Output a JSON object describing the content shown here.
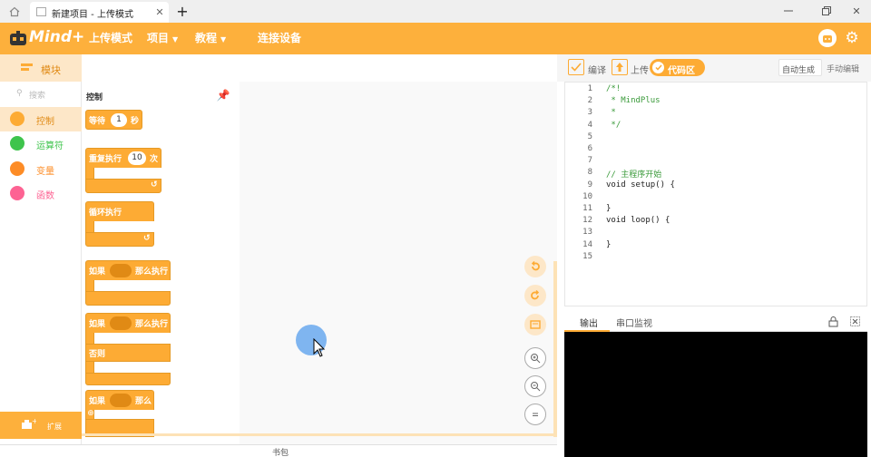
{
  "tab": {
    "title": "新建项目 - 上传模式"
  },
  "menubar": {
    "logo": "Mind+",
    "items": [
      {
        "label": "上传模式"
      },
      {
        "label": "项目"
      },
      {
        "label": "教程"
      },
      {
        "label": "连接设备"
      }
    ]
  },
  "sidebar": {
    "header": "模块",
    "search_placeholder": "搜索",
    "categories": [
      {
        "label": "控制",
        "color": "#fdab34"
      },
      {
        "label": "运算符",
        "color": "#3ec44c"
      },
      {
        "label": "变量",
        "color": "#fd8c26"
      },
      {
        "label": "函数",
        "color": "#fd6393"
      }
    ],
    "extension": "扩展"
  },
  "palette": {
    "title": "控制",
    "wait": {
      "label": "等待",
      "value": "1",
      "unit": "秒"
    },
    "repeat": {
      "label": "重复执行",
      "value": "10",
      "unit": "次"
    },
    "forever": {
      "label": "循环执行"
    },
    "if_then": {
      "label": "如果",
      "then": "那么执行"
    },
    "if_else": {
      "label": "如果",
      "then": "那么执行",
      "else": "否则"
    },
    "if_partial": {
      "label": "如果",
      "then": "那么"
    }
  },
  "bottom": {
    "backpack": "书包"
  },
  "rightbar": {
    "compile": "编译",
    "upload": "上传",
    "code_area": "代码区",
    "auto_gen": "自动生成",
    "manual_edit": "手动编辑"
  },
  "code": {
    "lines": [
      {
        "n": "1",
        "text": "/*!"
      },
      {
        "n": "2",
        "text": " * MindPlus"
      },
      {
        "n": "3",
        "text": " *"
      },
      {
        "n": "4",
        "text": " */"
      },
      {
        "n": "5",
        "text": ""
      },
      {
        "n": "6",
        "text": ""
      },
      {
        "n": "7",
        "text": ""
      },
      {
        "n": "8",
        "text": "// 主程序开始"
      },
      {
        "n": "9",
        "text": "void setup() {"
      },
      {
        "n": "10",
        "text": ""
      },
      {
        "n": "11",
        "text": "}"
      },
      {
        "n": "12",
        "text": "void loop() {"
      },
      {
        "n": "13",
        "text": ""
      },
      {
        "n": "14",
        "text": "}"
      },
      {
        "n": "15",
        "text": ""
      }
    ]
  },
  "output": {
    "tab_output": "输出",
    "tab_serial": "串口监视"
  },
  "colors": {
    "brand": "#fdb03c",
    "block": "#fdab34"
  }
}
